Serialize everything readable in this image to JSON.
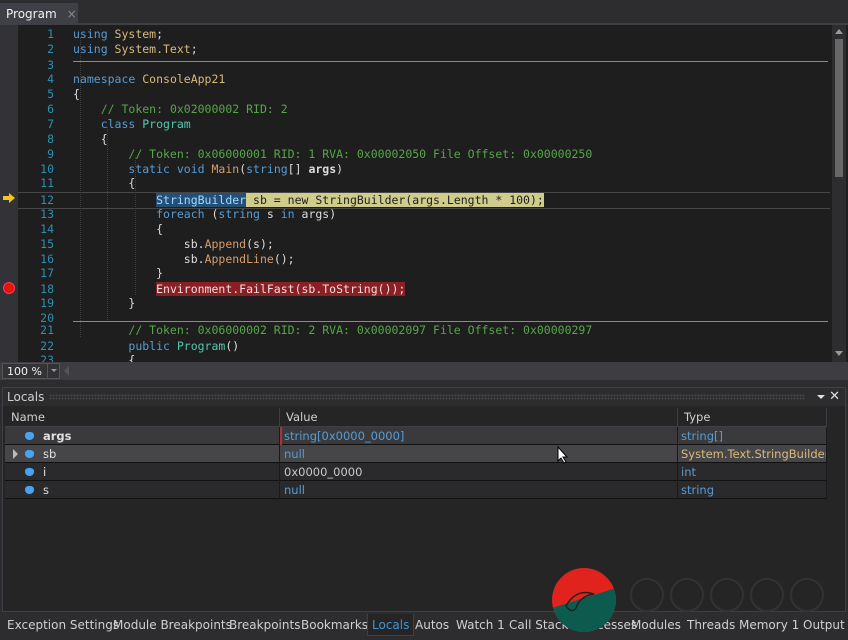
{
  "document_tab": {
    "title": "Program",
    "close": "×"
  },
  "editor": {
    "zoom_level": "100 %",
    "current_line": 12,
    "breakpoint_line": 18,
    "lines": [
      {
        "n": "1",
        "segments": [
          [
            "kw",
            "using "
          ],
          [
            "ns",
            "System"
          ],
          [
            "txt",
            ";"
          ]
        ]
      },
      {
        "n": "2",
        "segments": [
          [
            "kw",
            "using "
          ],
          [
            "ns",
            "System.Text"
          ],
          [
            "txt",
            ";"
          ]
        ]
      },
      {
        "n": "3",
        "segments": []
      },
      {
        "n": "4",
        "segments": [
          [
            "kw",
            "namespace "
          ],
          [
            "ns",
            "ConsoleApp21"
          ]
        ]
      },
      {
        "n": "5",
        "segments": [
          [
            "txt",
            "{"
          ]
        ]
      },
      {
        "n": "6",
        "segments": [
          [
            "txt",
            "    "
          ],
          [
            "cm",
            "// Token: 0x02000002 RID: 2"
          ]
        ]
      },
      {
        "n": "7",
        "segments": [
          [
            "txt",
            "    "
          ],
          [
            "kw",
            "class "
          ],
          [
            "ty",
            "Program"
          ]
        ]
      },
      {
        "n": "8",
        "segments": [
          [
            "txt",
            "    {"
          ]
        ]
      },
      {
        "n": "9",
        "segments": [
          [
            "txt",
            "        "
          ],
          [
            "cm",
            "// Token: 0x06000001 RID: 1 RVA: 0x00002050 File Offset: 0x00000250"
          ]
        ]
      },
      {
        "n": "10",
        "segments": [
          [
            "txt",
            "        "
          ],
          [
            "kw",
            "static void "
          ],
          [
            "mt",
            "Main"
          ],
          [
            "txt",
            "("
          ],
          [
            "kw",
            "string"
          ],
          [
            "txt",
            "[] "
          ],
          [
            "pm",
            "args"
          ],
          [
            "txt",
            ")"
          ]
        ]
      },
      {
        "n": "11",
        "segments": [
          [
            "txt",
            "        {"
          ]
        ]
      },
      {
        "n": "12",
        "segments": [
          [
            "txt",
            "            "
          ],
          [
            "hl-blue",
            "StringBuilder"
          ],
          [
            "hl-yellow",
            " sb = new StringBuilder(args.Length * 100);"
          ]
        ]
      },
      {
        "n": "13",
        "segments": [
          [
            "txt",
            "            "
          ],
          [
            "kw",
            "foreach "
          ],
          [
            "txt",
            "("
          ],
          [
            "kw",
            "string "
          ],
          [
            "txt",
            "s "
          ],
          [
            "kw",
            "in "
          ],
          [
            "txt",
            "args)"
          ]
        ]
      },
      {
        "n": "14",
        "segments": [
          [
            "txt",
            "            {"
          ]
        ]
      },
      {
        "n": "15",
        "segments": [
          [
            "txt",
            "                sb."
          ],
          [
            "mt",
            "Append"
          ],
          [
            "txt",
            "(s);"
          ]
        ]
      },
      {
        "n": "16",
        "segments": [
          [
            "txt",
            "                sb."
          ],
          [
            "mt",
            "AppendLine"
          ],
          [
            "txt",
            "();"
          ]
        ]
      },
      {
        "n": "17",
        "segments": [
          [
            "txt",
            "            }"
          ]
        ]
      },
      {
        "n": "18",
        "segments": [
          [
            "txt",
            "            "
          ],
          [
            "hl-red",
            "Environment.FailFast(sb.ToString());"
          ]
        ]
      },
      {
        "n": "19",
        "segments": [
          [
            "txt",
            "        }"
          ]
        ]
      },
      {
        "n": "20",
        "segments": []
      },
      {
        "n": "21",
        "segments": [
          [
            "txt",
            "        "
          ],
          [
            "cm",
            "// Token: 0x06000002 RID: 2 RVA: 0x00002097 File Offset: 0x00000297"
          ]
        ]
      },
      {
        "n": "22",
        "segments": [
          [
            "txt",
            "        "
          ],
          [
            "kw",
            "public "
          ],
          [
            "ty",
            "Program"
          ],
          [
            "txt",
            "()"
          ]
        ]
      },
      {
        "n": "23",
        "segments": [
          [
            "txt",
            "        {"
          ]
        ]
      }
    ]
  },
  "locals": {
    "title": "Locals",
    "columns": {
      "name": "Name",
      "value": "Value",
      "type": "Type"
    },
    "rows": [
      {
        "name": "args",
        "value": "string[0x0000_0000]",
        "type": "string[]",
        "expandable": false,
        "bold": true
      },
      {
        "name": "sb",
        "value": "null",
        "type": "System.Text.StringBuilder",
        "expandable": true,
        "bold": false
      },
      {
        "name": "i",
        "value": "0x0000_0000",
        "type": "int",
        "expandable": false,
        "bold": false
      },
      {
        "name": "s",
        "value": "null",
        "type": "string",
        "expandable": false,
        "bold": false
      }
    ]
  },
  "bottom_tabs": [
    {
      "label": "Exception Settings",
      "active": false
    },
    {
      "label": "Module Breakpoints",
      "active": false
    },
    {
      "label": "Breakpoints",
      "active": false
    },
    {
      "label": "Bookmarks",
      "active": false
    },
    {
      "label": "Locals",
      "active": true
    },
    {
      "label": "Autos",
      "active": false
    },
    {
      "label": "Watch 1",
      "active": false
    },
    {
      "label": "Call Stack",
      "active": false
    },
    {
      "label": "Processes",
      "active": false
    },
    {
      "label": "Modules",
      "active": false
    },
    {
      "label": "Threads",
      "active": false
    },
    {
      "label": "Memory 1",
      "active": false
    },
    {
      "label": "Output",
      "active": false
    }
  ]
}
